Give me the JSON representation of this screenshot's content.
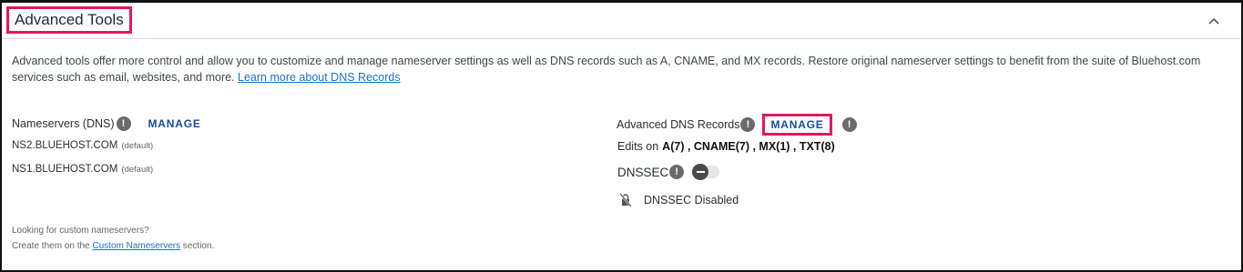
{
  "panel": {
    "title": "Advanced Tools",
    "collapse_icon": "chevron-up-icon"
  },
  "description": {
    "text": "Advanced tools offer more control and allow you to customize and manage nameserver settings as well as DNS records such as A, CNAME, and MX records. Restore original nameserver settings to benefit from the suite of Bluehost.com services such as email, websites, and more.",
    "link_text": "Learn more about DNS Records"
  },
  "nameservers": {
    "label": "Nameservers (DNS)",
    "info_icon": "info-icon",
    "manage_label": "MANAGE",
    "items": [
      {
        "host": "NS2.BLUEHOST.COM",
        "tag": "(default)"
      },
      {
        "host": "NS1.BLUEHOST.COM",
        "tag": "(default)"
      }
    ],
    "custom_prompt": "Looking for custom nameservers?",
    "custom_prefix": "Create them on the",
    "custom_link": "Custom Nameservers",
    "custom_suffix": "section."
  },
  "dns_records": {
    "label": "Advanced DNS Records",
    "manage_label": "MANAGE",
    "edits_prefix": "Edits on",
    "edits_summary": "A(7) , CNAME(7) , MX(1) , TXT(8)"
  },
  "dnssec": {
    "label": "DNSSEC",
    "enabled": false,
    "status_icon": "lock-slash-icon",
    "status_text": "DNSSEC Disabled"
  },
  "colors": {
    "highlight": "#e3195a",
    "manage": "#1b4b9a",
    "link": "#1f6fd1"
  }
}
